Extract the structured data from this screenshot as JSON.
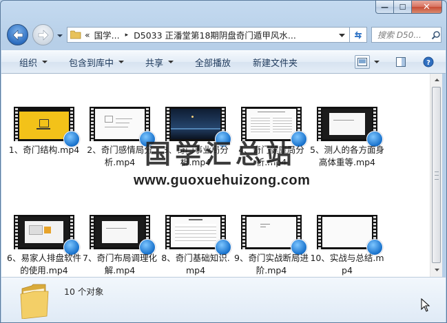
{
  "window": {
    "buttons": {
      "minimize": "—",
      "maximize": "☐",
      "close": "✕"
    }
  },
  "address_bar": {
    "chevron": "«",
    "crumbs": [
      "国学...",
      "D5033 正潘堂第18期阴盘奇门遁甲风水..."
    ],
    "separator": "▸"
  },
  "search": {
    "placeholder": "搜索 D50..."
  },
  "toolbar": {
    "organize": "组织",
    "include_library": "包含到库中",
    "share": "共享",
    "play_all": "全部播放",
    "new_folder": "新建文件夹"
  },
  "files": [
    {
      "name": "1、奇门结构.mp4",
      "thumb": "yellow"
    },
    {
      "name": "2、奇门感情局分析.mp4",
      "thumb": "doc"
    },
    {
      "name": "3、奇门事业局分析.mp4",
      "thumb": "dark"
    },
    {
      "name": "4、奇门健康局分析.mp4",
      "thumb": "doc2"
    },
    {
      "name": "5、测人的各方面身高体重等.mp4",
      "thumb": "slide"
    },
    {
      "name": "6、易家人排盘软件的使用.mp4",
      "thumb": "slide2"
    },
    {
      "name": "7、奇门布局调理化解.mp4",
      "thumb": "slide"
    },
    {
      "name": "8、奇门基础知识.mp4",
      "thumb": "doc3"
    },
    {
      "name": "9、奇门实战断局进阶.mp4",
      "thumb": "white"
    },
    {
      "name": "10、实战与总结.mp4",
      "thumb": "white"
    }
  ],
  "watermark": {
    "cn": "国学汇总站",
    "url": "www.guoxuehuizong.com"
  },
  "details": {
    "count_text": "10 个对象"
  },
  "colors": {
    "accent": "#1d76cf",
    "window_frame": "#b7cfe8",
    "toolbar_text": "#1e395b"
  }
}
